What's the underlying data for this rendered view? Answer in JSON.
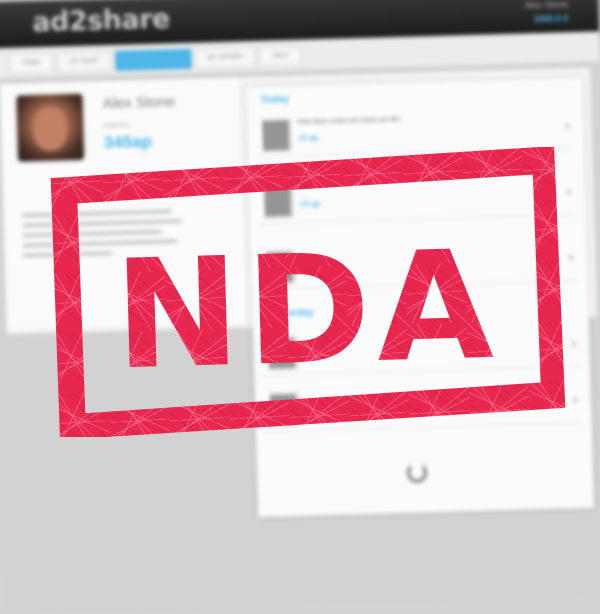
{
  "app": {
    "logo": "ad2share",
    "user_name": "Alex Stone",
    "user_balance": "1000.0 €",
    "nav_tabs": [
      "HOME",
      "MY SHOP",
      "",
      "MY OFFERS",
      "HELP"
    ]
  },
  "profile": {
    "name": "Alex Stone",
    "points_label": "POINTS",
    "points_value": "345ap"
  },
  "feed": {
    "section_today": "Today",
    "section_yesterday": "Yesterday",
    "items": [
      {
        "title": "Peter Black invited and shares ad offer",
        "points": "+5 ap"
      },
      {
        "title": "",
        "points": "+3 ap"
      },
      {
        "title": "",
        "points": ""
      },
      {
        "title": "",
        "points": ""
      },
      {
        "title": "",
        "points": ""
      }
    ]
  },
  "stamp": {
    "text": "NDA",
    "color": "#e8274f"
  }
}
